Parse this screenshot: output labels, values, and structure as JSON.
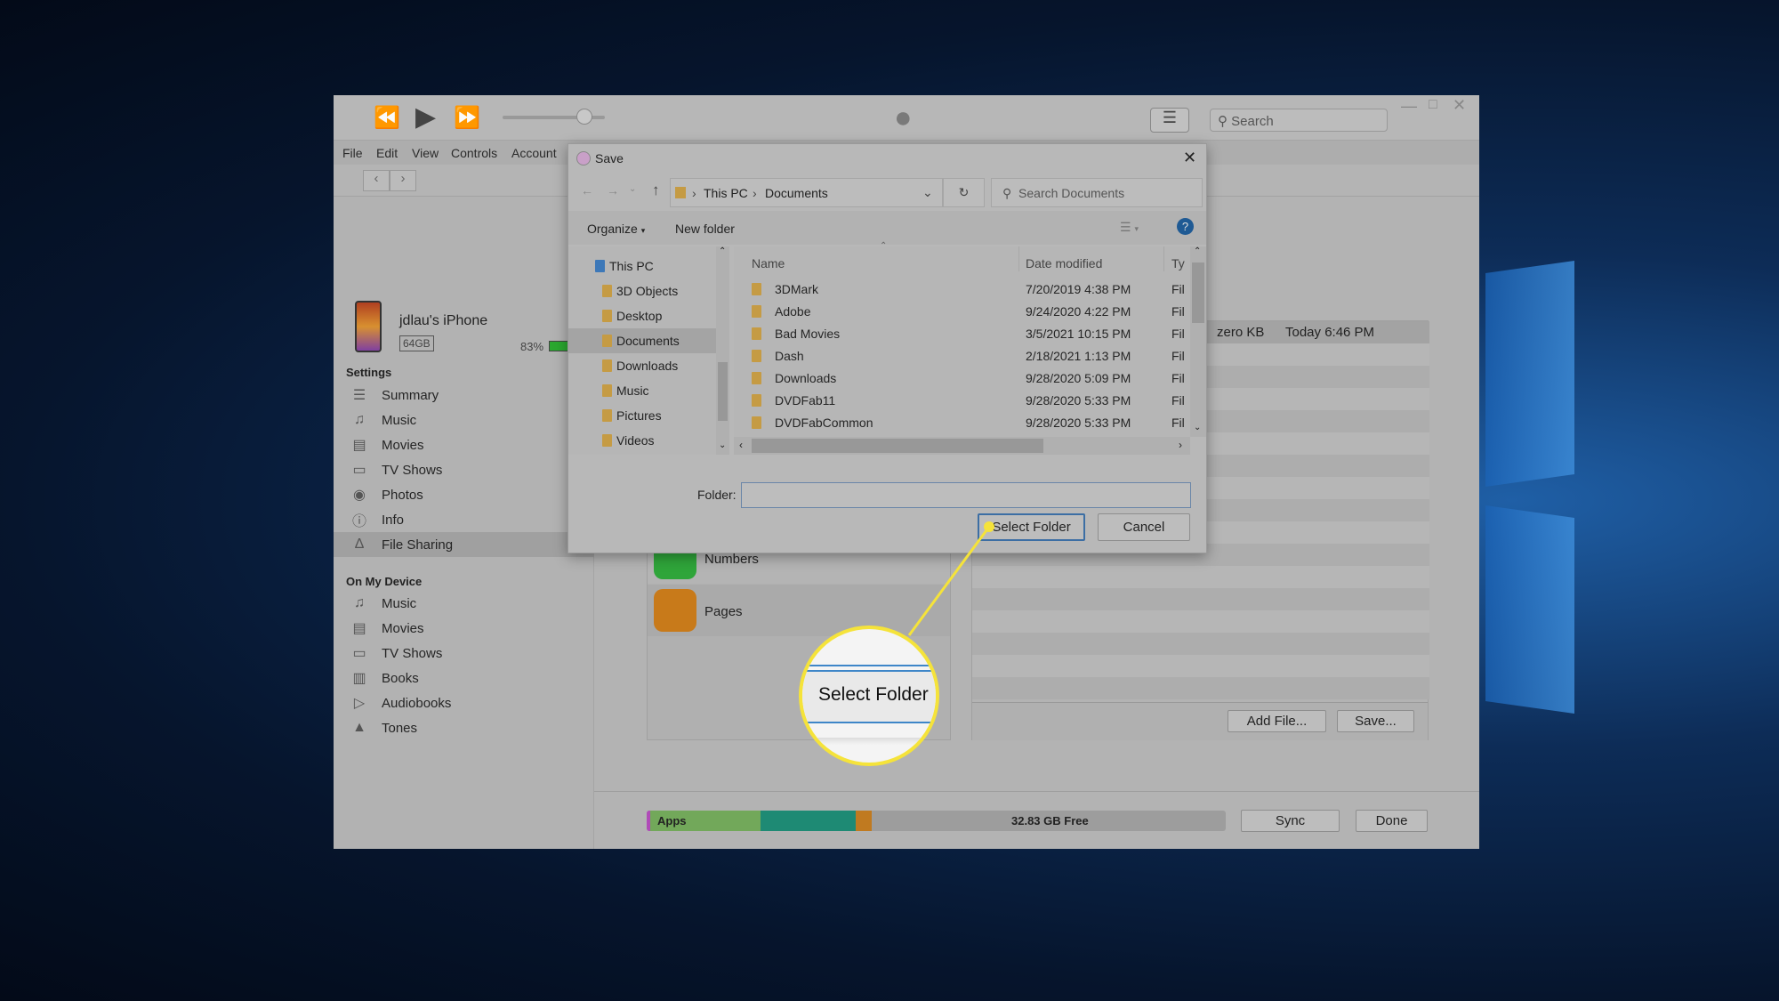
{
  "itunes": {
    "menu": [
      "File",
      "Edit",
      "View",
      "Controls",
      "Account"
    ],
    "search_placeholder": "Search",
    "volume": 0.85,
    "device": {
      "name": "jdlau's iPhone",
      "capacity": "64GB",
      "battery": "83%"
    },
    "settings_header": "Settings",
    "settings_items": [
      {
        "label": "Summary",
        "icon": "summary-icon"
      },
      {
        "label": "Music",
        "icon": "music-note-icon"
      },
      {
        "label": "Movies",
        "icon": "film-icon"
      },
      {
        "label": "TV Shows",
        "icon": "tv-icon"
      },
      {
        "label": "Photos",
        "icon": "camera-icon"
      },
      {
        "label": "Info",
        "icon": "info-icon"
      },
      {
        "label": "File Sharing",
        "icon": "app-store-icon",
        "selected": true
      }
    ],
    "device_header": "On My Device",
    "device_items": [
      {
        "label": "Music",
        "icon": "music-note-icon"
      },
      {
        "label": "Movies",
        "icon": "film-icon"
      },
      {
        "label": "TV Shows",
        "icon": "tv-icon"
      },
      {
        "label": "Books",
        "icon": "book-icon"
      },
      {
        "label": "Audiobooks",
        "icon": "audiobook-icon"
      },
      {
        "label": "Tones",
        "icon": "bell-icon"
      }
    ],
    "apps": [
      {
        "name": "Numbers",
        "color": "#2fa53a"
      },
      {
        "name": "Pages",
        "color": "#c87a1a"
      }
    ],
    "file_row": {
      "size": "zero KB",
      "date": "Today 6:46 PM"
    },
    "add_file": "Add File...",
    "save": "Save...",
    "storage": {
      "label": "Apps",
      "free": "32.83 GB Free",
      "segments": [
        {
          "color": "#b04ab8",
          "frac": 0.006
        },
        {
          "color": "#72a85a",
          "frac": 0.19
        },
        {
          "color": "#1e8a74",
          "frac": 0.165
        },
        {
          "color": "#c07a20",
          "frac": 0.028
        }
      ]
    },
    "sync": "Sync",
    "done": "Done"
  },
  "dialog": {
    "title": "Save",
    "breadcrumb": [
      "This PC",
      "Documents"
    ],
    "search_placeholder": "Search Documents",
    "organize": "Organize",
    "new_folder": "New folder",
    "tree": [
      {
        "label": "This PC"
      },
      {
        "label": "3D Objects"
      },
      {
        "label": "Desktop"
      },
      {
        "label": "Documents",
        "selected": true
      },
      {
        "label": "Downloads"
      },
      {
        "label": "Music"
      },
      {
        "label": "Pictures"
      },
      {
        "label": "Videos"
      }
    ],
    "columns": {
      "name": "Name",
      "date": "Date modified",
      "type": "Ty"
    },
    "files": [
      {
        "name": "3DMark",
        "date": "7/20/2019 4:38 PM",
        "type": "Fil"
      },
      {
        "name": "Adobe",
        "date": "9/24/2020 4:22 PM",
        "type": "Fil"
      },
      {
        "name": "Bad Movies",
        "date": "3/5/2021 10:15 PM",
        "type": "Fil"
      },
      {
        "name": "Dash",
        "date": "2/18/2021 1:13 PM",
        "type": "Fil"
      },
      {
        "name": "Downloads",
        "date": "9/28/2020 5:09 PM",
        "type": "Fil"
      },
      {
        "name": "DVDFab11",
        "date": "9/28/2020 5:33 PM",
        "type": "Fil"
      },
      {
        "name": "DVDFabCommon",
        "date": "9/28/2020 5:33 PM",
        "type": "Fil"
      }
    ],
    "folder_label": "Folder:",
    "folder_value": "",
    "select_folder": "Select Folder",
    "cancel": "Cancel"
  },
  "callout": {
    "label": "Select Folder",
    "color": "#f5e33a"
  }
}
